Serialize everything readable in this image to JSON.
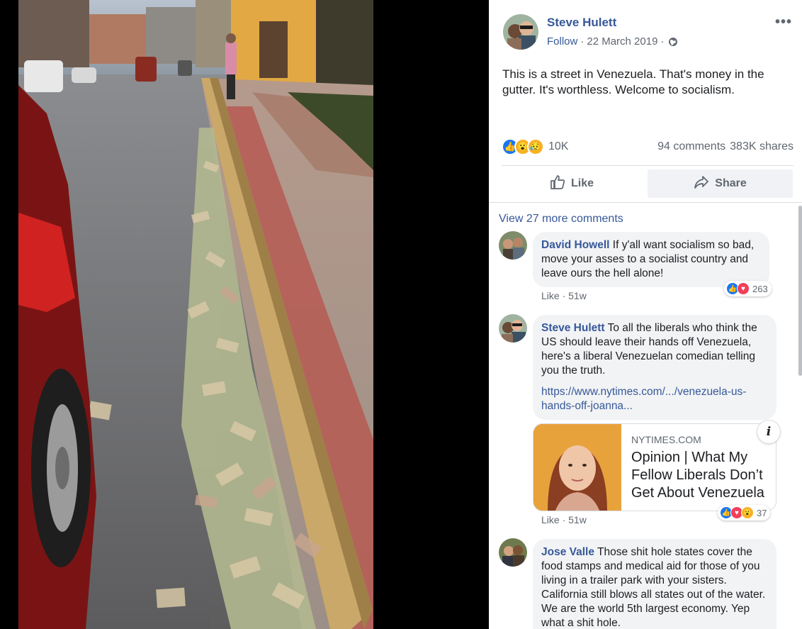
{
  "post": {
    "author": "Steve Hulett",
    "follow": "Follow",
    "date": "22 March 2019",
    "more": "•••",
    "text": "This is a street in Venezuela. That's money in the gutter. It's worthless. Welcome to socialism.",
    "reaction_count": "10K",
    "comments": "94 comments",
    "shares": "383K shares",
    "like_label": "Like",
    "share_label": "Share"
  },
  "comments_section": {
    "view_more": "View 27 more comments",
    "items": [
      {
        "name": "David Howell",
        "text": "If y'all want socialism so bad, move your asses to a socialist country and leave ours the hell alone!",
        "like": "Like",
        "time": "51w",
        "reactions": "263"
      },
      {
        "name": "Steve Hulett",
        "text": "To all the liberals who think the US should leave their hands off Venezuela, here's a liberal Venezuelan comedian telling you the truth.",
        "link": "https://www.nytimes.com/.../venezuela-us-hands-off-joanna...",
        "card_domain": "NYTIMES.COM",
        "card_title": "Opinion | What My Fellow Liberals Don’t Get About Venezuela",
        "like": "Like",
        "time": "51w",
        "reactions": "37"
      },
      {
        "name": "Jose Valle",
        "text": "Those shit hole states cover the food stamps and medical aid for those of you living in a trailer park with your sisters. California still blows all states out of the water. We are the world 5th largest economy. Yep what a shit hole."
      }
    ]
  },
  "icons": {
    "globe": "globe-icon",
    "like": "thumbs-up-icon",
    "share": "share-arrow-icon",
    "info": "info-icon"
  },
  "colors": {
    "link_blue": "#365899",
    "like_blue": "#1877f2",
    "love_red": "#f33e58",
    "wow_yellow": "#f7b125"
  }
}
